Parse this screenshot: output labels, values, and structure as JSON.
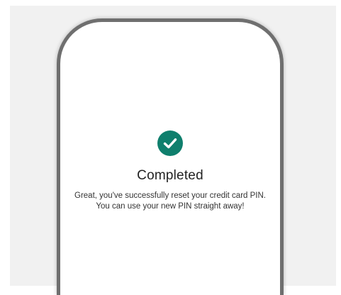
{
  "status": {
    "icon": "check-circle-icon",
    "accent_color": "#0f7f6d",
    "title": "Completed",
    "message": "Great, you've successfully reset your credit card PIN. You can use your new PIN straight away!"
  }
}
